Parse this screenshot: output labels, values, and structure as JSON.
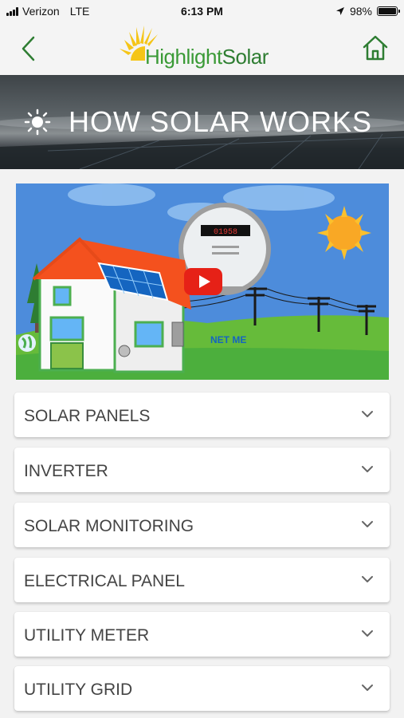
{
  "status_bar": {
    "carrier": "Verizon",
    "network": "LTE",
    "time": "6:13 PM",
    "battery": "98%",
    "battery_level": 0.98,
    "icons": [
      "signal-icon",
      "location-icon",
      "battery-icon"
    ]
  },
  "header": {
    "logo_text_part1": "Highlight",
    "logo_text_part2": "Solar",
    "back_icon": "chevron-left-icon",
    "home_icon": "home-icon"
  },
  "banner": {
    "title": "HOW SOLAR WORKS",
    "icon": "sun-icon"
  },
  "video": {
    "meter_label": "NET ME",
    "meter_digits": "01958",
    "play_icon": "play-icon"
  },
  "sections": [
    {
      "label": "SOLAR PANELS"
    },
    {
      "label": "INVERTER"
    },
    {
      "label": "SOLAR MONITORING"
    },
    {
      "label": "ELECTRICAL PANEL"
    },
    {
      "label": "UTILITY METER"
    },
    {
      "label": "UTILITY GRID"
    }
  ],
  "colors": {
    "brand_green": "#3a9a36",
    "dark_green": "#2e7d32",
    "youtube_red": "#e62117"
  }
}
